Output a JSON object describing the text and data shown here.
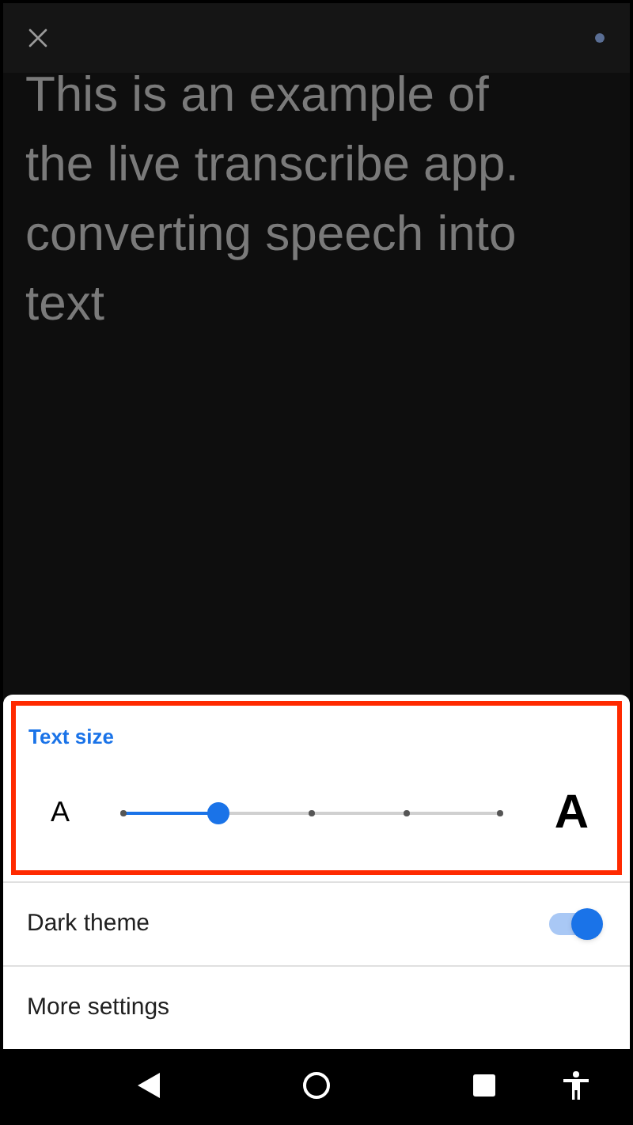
{
  "transcript": {
    "lines": [
      "This is an example of",
      "the live transcribe app.",
      "converting speech into",
      "text"
    ]
  },
  "settings_sheet": {
    "text_size": {
      "title": "Text size",
      "highlighted": true,
      "small_label": "A",
      "large_label": "A",
      "level": 0.25
    },
    "rows": [
      {
        "kind": "toggle",
        "label": "Dark theme",
        "on": true
      },
      {
        "kind": "link",
        "label": "More settings"
      }
    ]
  }
}
